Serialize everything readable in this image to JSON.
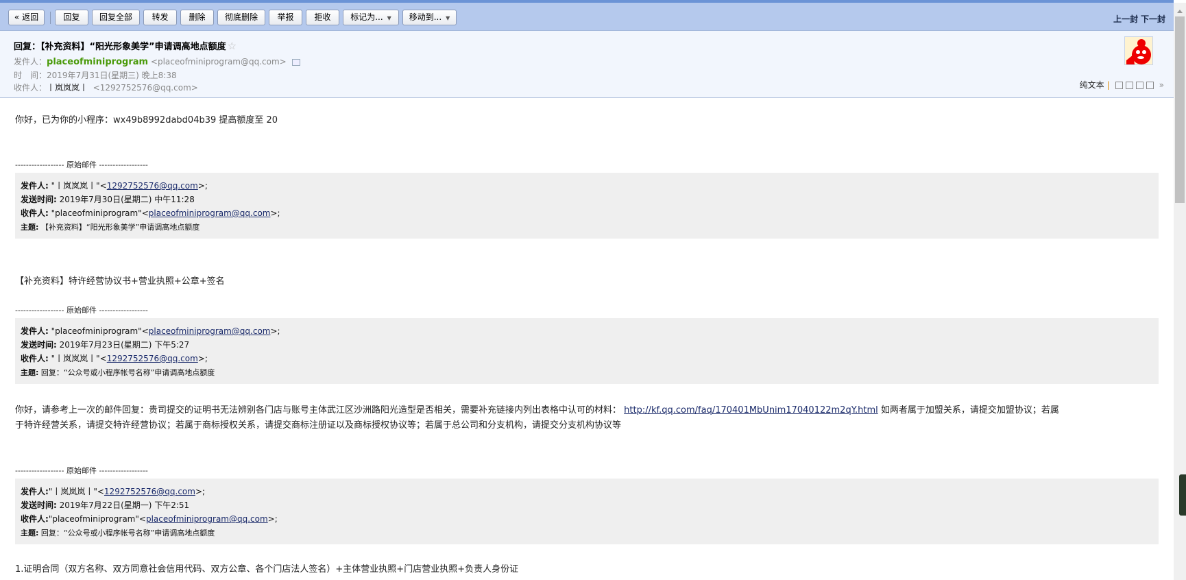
{
  "toolbar": {
    "back": "« 返回",
    "reply": "回复",
    "reply_all": "回复全部",
    "forward": "转发",
    "delete": "删除",
    "delete_perm": "彻底删除",
    "report": "举报",
    "reject": "拒收",
    "mark_as": "标记为...",
    "move_to": "移动到...",
    "prev": "上一封",
    "next": "下一封"
  },
  "header": {
    "subject": "回复：【补充资料】“阳光形象美学”申请调高地点额度",
    "from_label": "发件人：",
    "from_name": "placeofminiprogram",
    "from_email": "<placeofminiprogram@qq.com>",
    "time_label": "时　间：",
    "time": "2019年7月31日(星期三) 晚上8:38",
    "to_label": "收件人：",
    "to_name": "丨岚岚岚丨",
    "to_email": "<1292752576@qq.com>",
    "plain_text": "纯文本"
  },
  "body": {
    "line1": "你好，已为你的小程序：wx49b8992dabd04b39 提高额度至 20",
    "divider": "------------------ 原始邮件 ------------------",
    "quote1": {
      "from_label": "发件人:",
      "from_pre": " \"丨岚岚岚丨\"<",
      "from_email": "1292752576@qq.com",
      "from_post": ">;",
      "time_label": "发送时间:",
      "time": " 2019年7月30日(星期二) 中午11:28",
      "to_label": "收件人:",
      "to_pre": " \"placeofminiprogram\"<",
      "to_email": "placeofminiprogram@qq.com",
      "to_post": ">;",
      "subject_label": "主题:",
      "subject": " 【补充资料】“阳光形象美学”申请调高地点额度"
    },
    "line2": "【补充资料】特许经营协议书+营业执照+公章+签名",
    "quote2": {
      "from_label": "发件人:",
      "from_pre": " \"placeofminiprogram\"<",
      "from_email": "placeofminiprogram@qq.com",
      "from_post": ">;",
      "time_label": "发送时间:",
      "time": " 2019年7月23日(星期二) 下午5:27",
      "to_label": "收件人:",
      "to_pre": " \"丨岚岚岚丨\"<",
      "to_email": "1292752576@qq.com",
      "to_post": ">;",
      "subject_label": "主题:",
      "subject": " 回复：“公众号或小程序帐号名称”申请调高地点额度"
    },
    "para_a": "你好，请参考上一次的邮件回复：贵司提交的证明书无法辨别各门店与账号主体武江区沙洲路阳光造型是否相关，需要补充链接内列出表格中认可的材料： ",
    "para_link": "http://kf.qq.com/faq/170401MbUnim17040122m2qY.html",
    "para_b": "  如两者属于加盟关系，请提交加盟协议；若属",
    "para_c": "于特许经营关系，请提交特许经营协议；若属于商标授权关系，请提交商标注册证以及商标授权协议等；若属于总公司和分支机构，请提交分支机构协议等",
    "quote3": {
      "from_label": "发件人:",
      "from_pre": "\"丨岚岚岚丨\"<",
      "from_email": "1292752576@qq.com",
      "from_post": ">;",
      "time_label": "发送时间:",
      "time": " 2019年7月22日(星期一) 下午2:51",
      "to_label": "收件人:",
      "to_pre": "\"placeofminiprogram\"<",
      "to_email": "placeofminiprogram@qq.com",
      "to_post": ">;",
      "subject_label": "主题:",
      "subject": " 回复：“公众号或小程序帐号名称”申请调高地点额度"
    },
    "line3": "1.证明合同（双方名称、双方同意社会信用代码、双方公章、各个门店法人签名）+主体营业执照+门店营业执照+负责人身份证"
  }
}
